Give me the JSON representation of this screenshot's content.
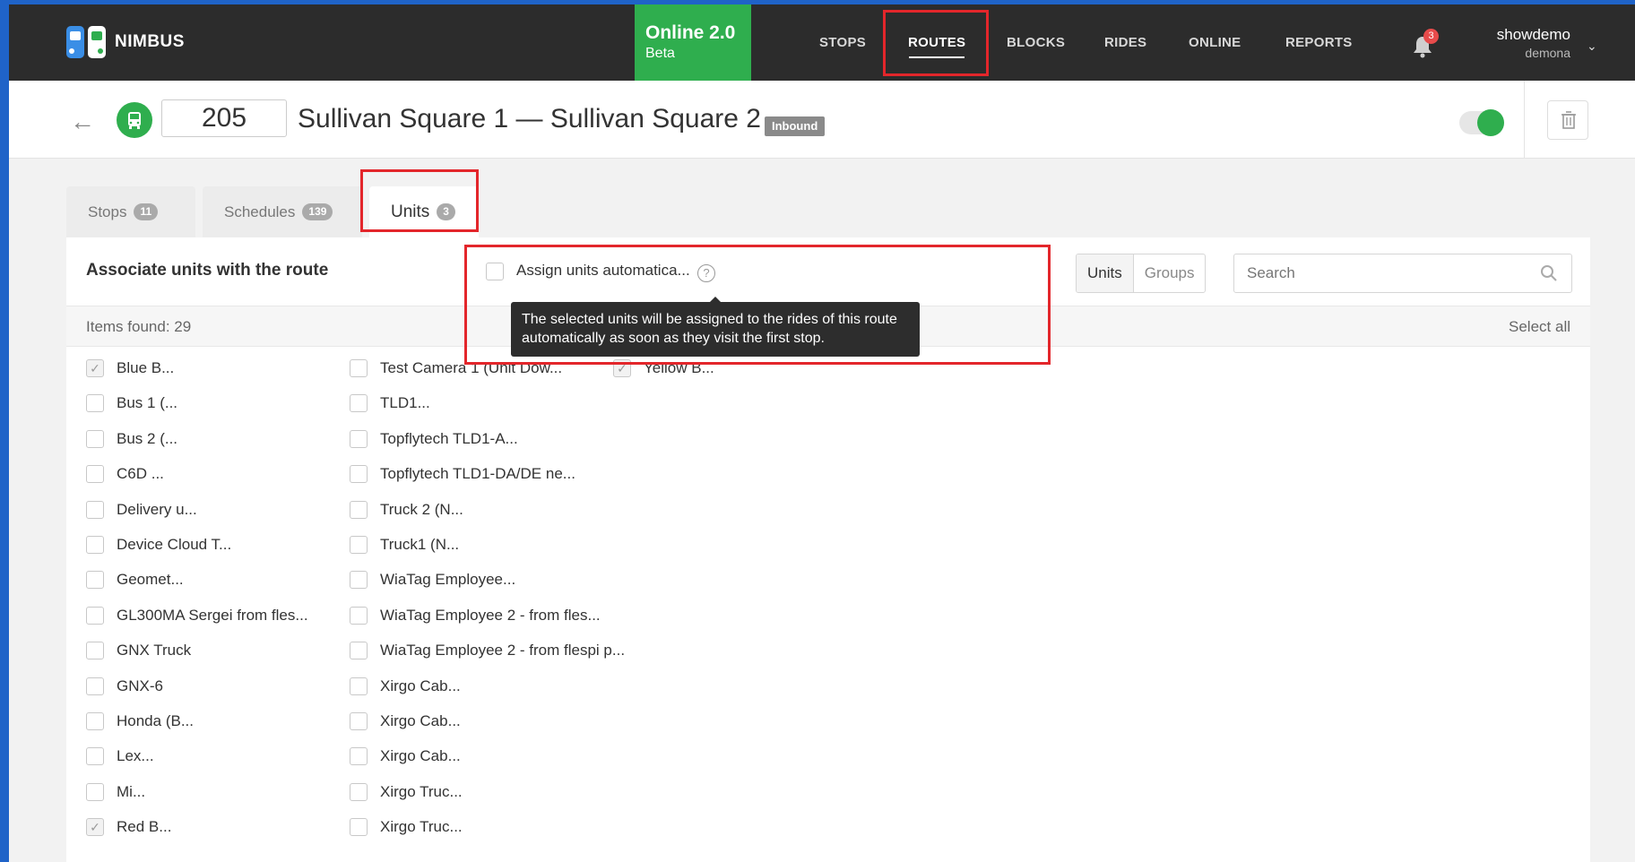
{
  "app": {
    "name": "NIMBUS"
  },
  "online_box": {
    "title": "Online 2.0",
    "subtitle": "Beta"
  },
  "nav": [
    {
      "label": "STOPS",
      "active": false
    },
    {
      "label": "ROUTES",
      "active": true
    },
    {
      "label": "BLOCKS",
      "active": false
    },
    {
      "label": "RIDES",
      "active": false
    },
    {
      "label": "ONLINE",
      "active": false
    },
    {
      "label": "REPORTS",
      "active": false
    }
  ],
  "notifications": {
    "count": "3",
    "icon": "bell-icon"
  },
  "user": {
    "name": "showdemo",
    "account": "demona"
  },
  "route": {
    "number": "205",
    "title": "Sullivan Square 1 — Sullivan Square 2",
    "direction_badge": "Inbound",
    "enabled": true
  },
  "tabs": [
    {
      "label": "Stops",
      "count": "11",
      "active": false
    },
    {
      "label": "Schedules",
      "count": "139",
      "active": false
    },
    {
      "label": "Units",
      "count": "3",
      "active": true
    }
  ],
  "panel": {
    "title": "Associate units with the route",
    "auto_assign_label": "Assign units automatica...",
    "auto_assign_checked": false,
    "tooltip": "The selected units will be assigned to the rides of this route automatically as soon as they visit the first stop.",
    "segment": [
      "Units",
      "Groups"
    ],
    "search_placeholder": "Search",
    "items_found": "Items found: 29",
    "select_all": "Select all"
  },
  "units": {
    "col1": [
      {
        "name": "Blue B...",
        "checked": true
      },
      {
        "name": "Bus 1 (...",
        "checked": false
      },
      {
        "name": "Bus 2 (...",
        "checked": false
      },
      {
        "name": "C6D ...",
        "checked": false
      },
      {
        "name": "Delivery u...",
        "checked": false
      },
      {
        "name": "Device Cloud T...",
        "checked": false
      },
      {
        "name": "Geomet...",
        "checked": false
      },
      {
        "name": "GL300MA Sergei from fles...",
        "checked": false
      },
      {
        "name": "GNX Truck",
        "checked": false
      },
      {
        "name": "GNX-6",
        "checked": false
      },
      {
        "name": "Honda (B...",
        "checked": false
      },
      {
        "name": "Lex...",
        "checked": false
      },
      {
        "name": "Mi...",
        "checked": false
      },
      {
        "name": "Red B...",
        "checked": true
      }
    ],
    "col2": [
      {
        "name": "Test Camera 1 (Unit Dow...",
        "checked": false
      },
      {
        "name": "TLD1...",
        "checked": false
      },
      {
        "name": "Topflytech TLD1-A...",
        "checked": false
      },
      {
        "name": "Topflytech TLD1-DA/DE ne...",
        "checked": false
      },
      {
        "name": "Truck 2 (N...",
        "checked": false
      },
      {
        "name": "Truck1 (N...",
        "checked": false
      },
      {
        "name": "WiaTag Employee...",
        "checked": false
      },
      {
        "name": "WiaTag Employee 2 - from fles...",
        "checked": false
      },
      {
        "name": "WiaTag Employee 2 - from flespi p...",
        "checked": false
      },
      {
        "name": "Xirgo Cab...",
        "checked": false
      },
      {
        "name": "Xirgo Cab...",
        "checked": false
      },
      {
        "name": "Xirgo Cab...",
        "checked": false
      },
      {
        "name": "Xirgo Truc...",
        "checked": false
      },
      {
        "name": "Xirgo Truc...",
        "checked": false
      }
    ],
    "col3": [
      {
        "name": "Yellow B...",
        "checked": true
      }
    ]
  },
  "colors": {
    "accent_green": "#2fae4e",
    "highlight_red": "#e3262b",
    "topbar": "#2c2c2c"
  }
}
